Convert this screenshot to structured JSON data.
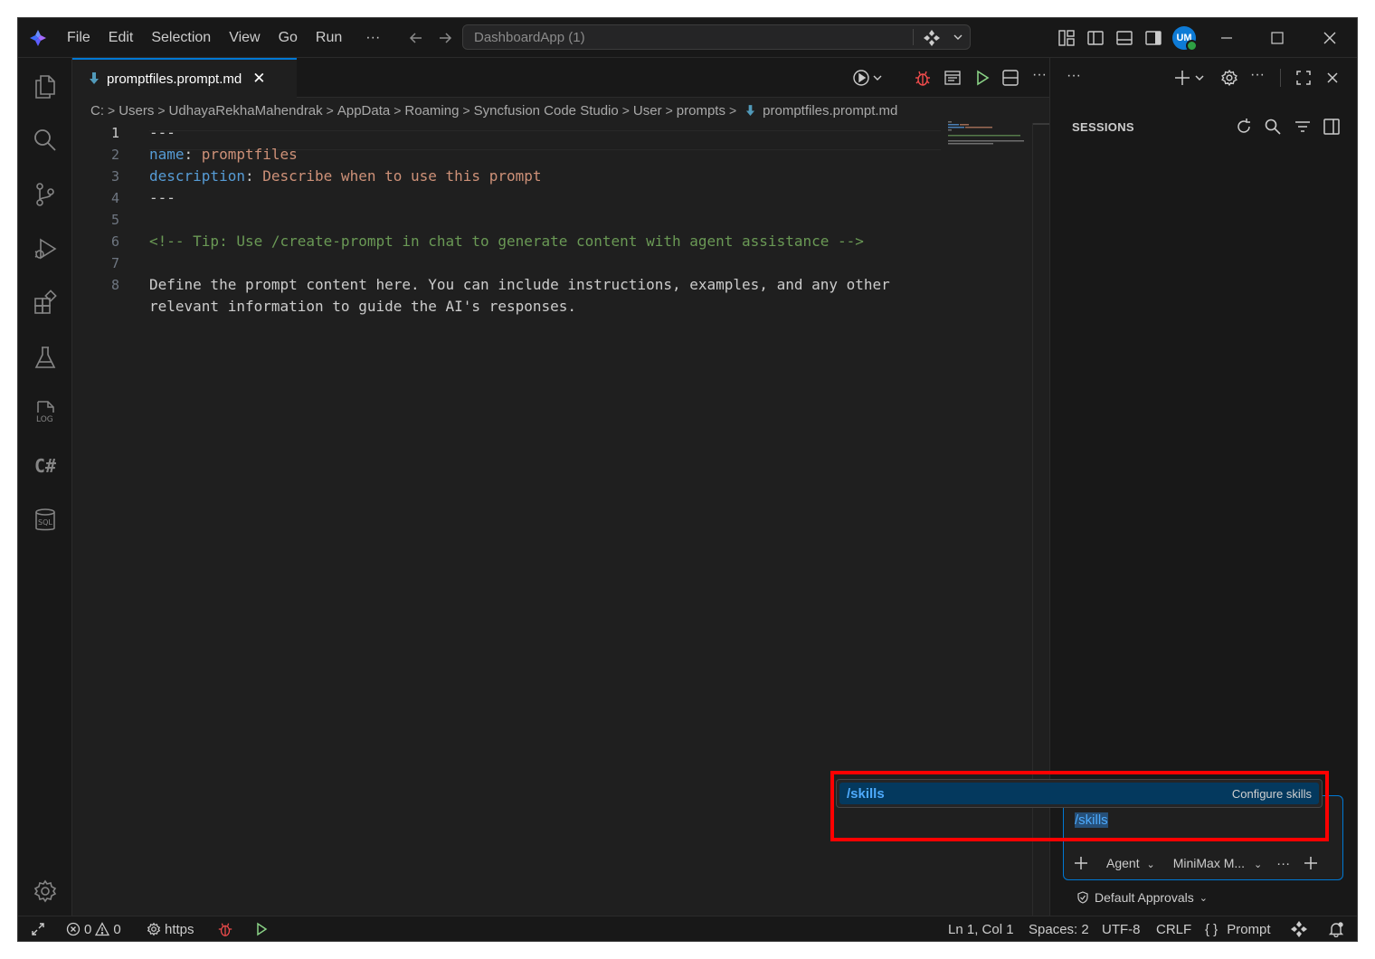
{
  "titlebar": {
    "menus": [
      "File",
      "Edit",
      "Selection",
      "View",
      "Go",
      "Run"
    ],
    "more": "···",
    "command_center": "DashboardApp (1)",
    "avatar": "UM"
  },
  "editor": {
    "tab": {
      "label": "promptfiles.prompt.md",
      "close": "✕"
    },
    "breadcrumb": [
      "C:",
      "Users",
      "UdhayaRekhaMahendrak",
      "AppData",
      "Roaming",
      "Syncfusion Code Studio",
      "User",
      "prompts",
      "promptfiles.prompt.md"
    ],
    "line_numbers": [
      "1",
      "2",
      "3",
      "4",
      "5",
      "6",
      "7",
      "8"
    ],
    "lines": {
      "l1": "---",
      "l2_key": "name",
      "l2_sep": ": ",
      "l2_val": "promptfiles",
      "l3_key": "description",
      "l3_sep": ": ",
      "l3_val": "Describe when to use this prompt",
      "l4": "---",
      "l6": "<!-- Tip: Use /create-prompt in chat to generate content with agent assistance -->",
      "l8a": "Define the prompt content here. You can include instructions, examples, and any other",
      "l8b": "relevant information to guide the AI's responses."
    }
  },
  "panel": {
    "more": "···",
    "title": "SESSIONS",
    "chat": {
      "input": "/skills",
      "mode": "Agent",
      "model": "MiniMax M...",
      "more": "···"
    },
    "approvals": "Default Approvals"
  },
  "suggestion": {
    "command": "/skills",
    "description": "Configure skills"
  },
  "statusbar": {
    "errors": "0",
    "warnings": "0",
    "https": "https",
    "position": "Ln 1, Col 1",
    "spaces": "Spaces: 2",
    "encoding": "UTF-8",
    "eol": "CRLF",
    "language_braces": "{ }",
    "language": "Prompt"
  },
  "colors": {
    "accent": "#0078d4",
    "highlight_box": "#ff0000",
    "keyword": "#569cd6",
    "string": "#ce9178",
    "comment": "#6a9955",
    "debug": "#f14c4c",
    "run": "#89d185"
  }
}
